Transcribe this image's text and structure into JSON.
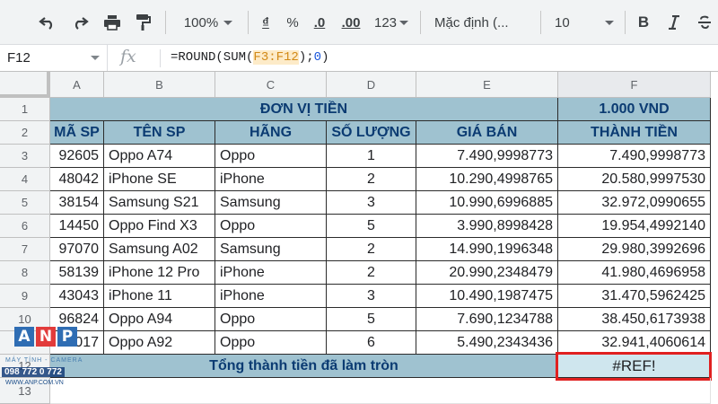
{
  "toolbar": {
    "zoom": "100%",
    "currency_symbol": "₫",
    "percent_symbol": "%",
    "decimal_decrease": ".0",
    "decimal_increase": ".00",
    "number_format": "123",
    "font_name": "Mặc định (...",
    "font_size": "10",
    "bold_label": "B"
  },
  "formula_bar": {
    "cell_ref": "F12",
    "fx_label": "fx",
    "formula_prefix": "=ROUND(SUM(",
    "formula_range": "F3:F12",
    "formula_mid": ");",
    "formula_digits": "0",
    "formula_suffix": ")"
  },
  "columns": [
    "A",
    "B",
    "C",
    "D",
    "E",
    "F"
  ],
  "rows": [
    "1",
    "2",
    "3",
    "4",
    "5",
    "6",
    "7",
    "8",
    "9",
    "10",
    "11",
    "12",
    "13"
  ],
  "sheet": {
    "title_unit": "ĐƠN VỊ TIỀN",
    "title_value": "1.000 VND",
    "headers": [
      "MÃ SP",
      "TÊN SP",
      "HÃNG",
      "SỐ LƯỢNG",
      "GIÁ BÁN",
      "THÀNH TIỀN"
    ],
    "data": [
      [
        "92605",
        "Oppo A74",
        "Oppo",
        "1",
        "7.490,9998773",
        "7.490,9998773"
      ],
      [
        "48042",
        "iPhone SE",
        "iPhone",
        "2",
        "10.290,4998765",
        "20.580,9997530"
      ],
      [
        "38154",
        "Samsung S21",
        "Samsung",
        "3",
        "10.990,6996885",
        "32.972,0990655"
      ],
      [
        "14450",
        "Oppo Find X3",
        "Oppo",
        "5",
        "3.990,8998428",
        "19.954,4992140"
      ],
      [
        "97070",
        "Samsung A02",
        "Samsung",
        "2",
        "14.990,1996348",
        "29.980,3992696"
      ],
      [
        "58139",
        "iPhone 12 Pro",
        "iPhone",
        "2",
        "20.990,2348479",
        "41.980,4696958"
      ],
      [
        "43043",
        "iPhone 11",
        "iPhone",
        "3",
        "10.490,1987475",
        "31.470,5962425"
      ],
      [
        "96824",
        "Oppo A94",
        "Oppo",
        "5",
        "7.690,1234788",
        "38.450,6173938"
      ],
      [
        "40017",
        "Oppo A92",
        "Oppo",
        "6",
        "5.490,2343436",
        "32.941,4060614"
      ]
    ],
    "total_label": "Tổng thành tiền đã làm tròn",
    "total_value": "#REF!"
  },
  "logo": {
    "letters": [
      "A",
      "N",
      "P"
    ],
    "tagline": "MÁY TÍNH - CAMERA",
    "phone": "098 772 0 772",
    "website": "WWW.ANP.COM.VN",
    "colors": [
      "#2f6db3",
      "#e23b3b",
      "#2f6db3"
    ]
  },
  "colors": {
    "header_fill": "#9fc2d0",
    "header_text": "#0b3b72",
    "ref_fill": "#cfe6ee",
    "highlight_border": "#e02020",
    "formula_range": "#d28a18"
  }
}
